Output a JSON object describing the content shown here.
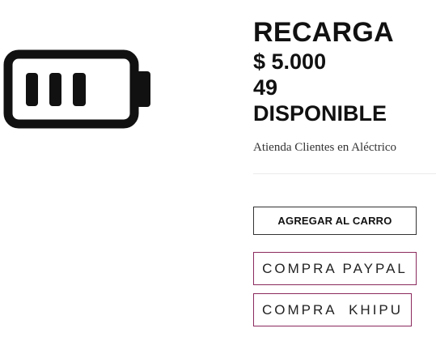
{
  "product": {
    "title": "RECARGA",
    "price": "$ 5.000",
    "stock_count": "49",
    "stock_label": "DISPONIBLE",
    "vendor": "Atienda Clientes en Aléctrico",
    "image_icon": "battery-icon"
  },
  "actions": {
    "add_to_cart": "AGREGAR AL CARRO",
    "buy_paypal": "COMPRA PAYPAL",
    "buy_khipu": "COMPRA  KHIPU"
  },
  "colors": {
    "text": "#111111",
    "accent_border": "#8b2a5d",
    "cart_border": "#333333",
    "divider": "#eaeaea"
  }
}
